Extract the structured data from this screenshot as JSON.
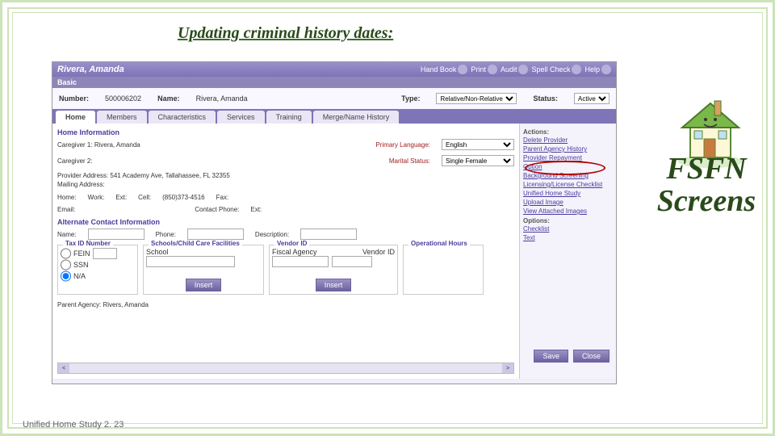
{
  "slideTitle": "Updating criminal history dates:",
  "sideLabel": "FSFN Screens",
  "footer": "Unified Home Study 2. 23",
  "app": {
    "name": "Rivera, Amanda",
    "toolbar": [
      "Hand Book",
      "Print",
      "Audit",
      "Spell Check",
      "Help"
    ],
    "basicHdr": "Basic",
    "number_lbl": "Number:",
    "number": "500006202",
    "name_lbl": "Name:",
    "type_lbl": "Type:",
    "type": "Relative/Non-Relative",
    "status_lbl": "Status:",
    "status": "Active"
  },
  "tabs": [
    "Home",
    "Members",
    "Characteristics",
    "Services",
    "Training",
    "Merge/Name History"
  ],
  "home": {
    "sectionHdr": "Home Information",
    "caregiver1_lbl": "Caregiver 1:",
    "caregiver1": "Rivera, Amanda",
    "caregiver2_lbl": "Caregiver 2:",
    "primlang_lbl": "Primary Language:",
    "primlang": "English",
    "marital_lbl": "Marital Status:",
    "marital": "Single Female",
    "provaddr_lbl": "Provider Address:",
    "provaddr": "541 Academy Ave, Tallahassee, FL 32355",
    "mailaddr_lbl": "Mailing Address:",
    "contacts": {
      "home": "Home:",
      "work": "Work:",
      "ext1": "Ext:",
      "cell_lbl": "Cell:",
      "cell": "(850)373-4516",
      "fax": "Fax:",
      "email": "Email:",
      "cphone": "Contact Phone:",
      "ext2": "Ext:"
    },
    "altHdr": "Alternate Contact Information",
    "alt": {
      "name": "Name:",
      "phone": "Phone:",
      "desc": "Description:"
    },
    "boxes": {
      "taxid": "Tax ID Number",
      "fein": "FEIN",
      "ssn": "SSN",
      "na": "N/A",
      "schools": "Schools/Child Care Facilities",
      "school": "School",
      "insert": "Insert",
      "vendor": "Vendor ID",
      "fiscal": "Fiscal Agency",
      "vid": "Vendor ID",
      "ophours": "Operational Hours"
    },
    "parent_lbl": "Parent Agency:",
    "parent": "Rivers, Amanda"
  },
  "sidebar": {
    "actions": "Actions:",
    "links": [
      "Delete Provider",
      "Parent Agency History",
      "Provider Repayment",
      "Option",
      "Background Screening",
      "Licensing/License Checklist",
      "Unified Home Study",
      "Upload Image",
      "View Attached Images"
    ],
    "options": "Options:",
    "optlinks": [
      "Checklist",
      "Text"
    ]
  },
  "btns": {
    "save": "Save",
    "close": "Close"
  }
}
